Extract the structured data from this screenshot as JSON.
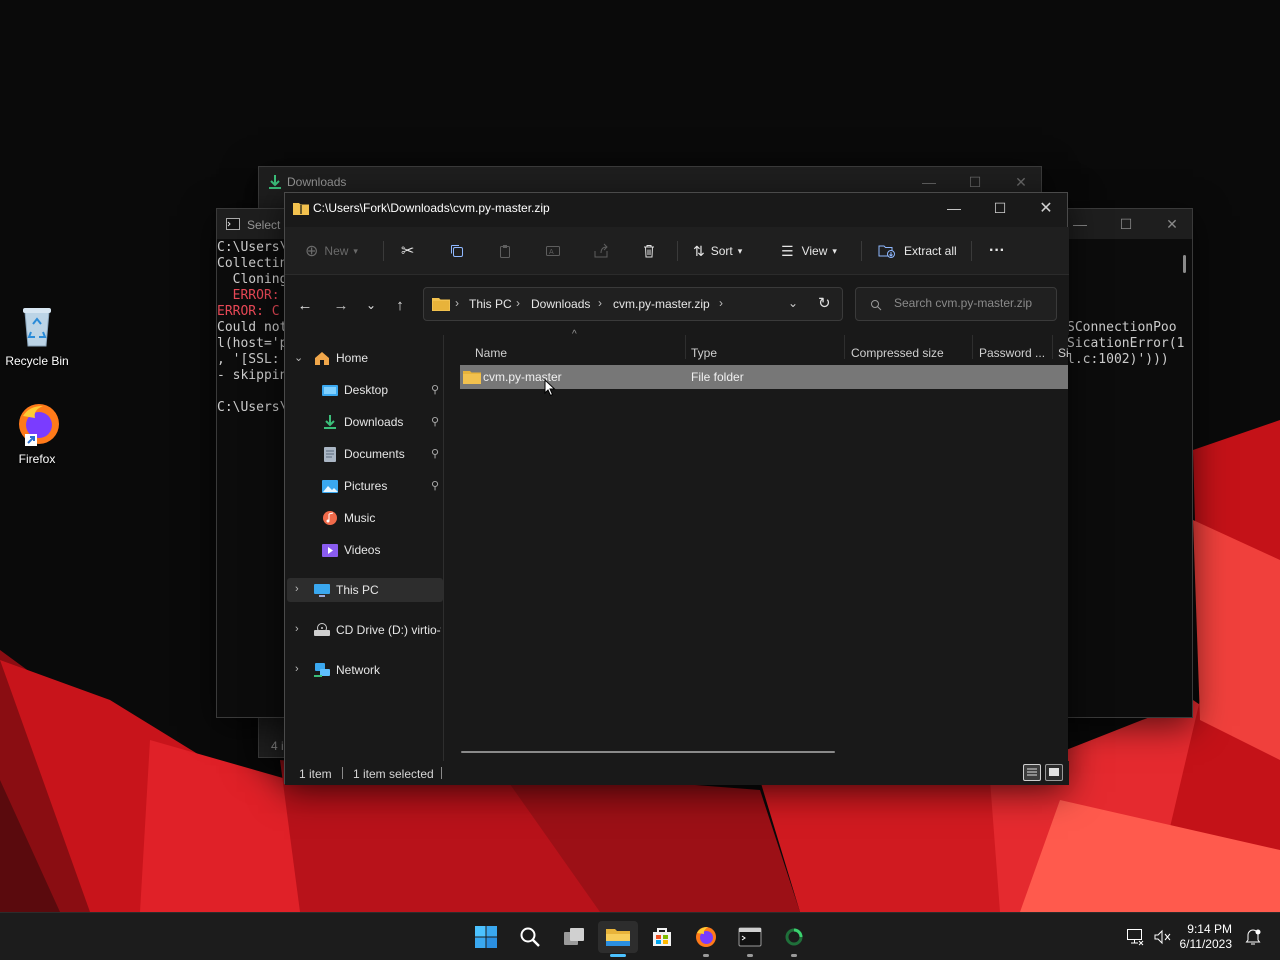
{
  "desktop": {
    "icons": [
      {
        "label": "Recycle Bin"
      },
      {
        "label": "Firefox"
      }
    ]
  },
  "downloads_window": {
    "title": "Downloads",
    "footer": "4 i"
  },
  "console_window": {
    "title": "Select C",
    "lines": [
      {
        "text": "C:\\Users\\",
        "kind": "normal"
      },
      {
        "text": "Collectin",
        "kind": "normal"
      },
      {
        "text": "  Cloning",
        "kind": "normal"
      },
      {
        "text": "  ERROR: ",
        "kind": "error"
      },
      {
        "text": "ERROR: C",
        "kind": "error"
      },
      {
        "text": "Could not",
        "kind": "normal"
      },
      {
        "text": "l(host='p",
        "kind": "normal"
      },
      {
        "text": ", '[SSL: ",
        "kind": "normal"
      },
      {
        "text": "- skippin",
        "kind": "normal"
      },
      {
        "text": "",
        "kind": "normal"
      },
      {
        "text": "C:\\Users\\",
        "kind": "normal"
      }
    ],
    "right_lines": [
      "SConnectionPoo",
      "SicationError(1",
      "l.c:1002)')))"
    ]
  },
  "explorer": {
    "title": "C:\\Users\\Fork\\Downloads\\cvm.py-master.zip",
    "toolbar": {
      "new_label": "New",
      "sort_label": "Sort",
      "view_label": "View",
      "extract_label": "Extract all",
      "more_label": "···"
    },
    "breadcrumbs": [
      "This PC",
      "Downloads",
      "cvm.py-master.zip"
    ],
    "search": {
      "placeholder": "Search cvm.py-master.zip"
    },
    "nav": {
      "home": "Home",
      "quick_access": [
        {
          "label": "Desktop",
          "pinned": true
        },
        {
          "label": "Downloads",
          "pinned": true
        },
        {
          "label": "Documents",
          "pinned": true
        },
        {
          "label": "Pictures",
          "pinned": true
        },
        {
          "label": "Music",
          "pinned": false
        },
        {
          "label": "Videos",
          "pinned": false
        }
      ],
      "this_pc": "This PC",
      "cd_drive": "CD Drive (D:) virtio-win",
      "network": "Network"
    },
    "columns": [
      "Name",
      "Type",
      "Compressed size",
      "Password ...",
      "Si"
    ],
    "rows": [
      {
        "name": "cvm.py-master",
        "type": "File folder",
        "selected": true
      }
    ],
    "status": {
      "count": "1 item",
      "selected": "1 item selected"
    }
  },
  "taskbar": {
    "time": "9:14 PM",
    "date": "6/11/2023"
  },
  "colors": {
    "accent": "#4cc2ff",
    "folder": "#f2c14e",
    "error_text": "#e74856",
    "wallpaper_red": "#d4141c"
  }
}
